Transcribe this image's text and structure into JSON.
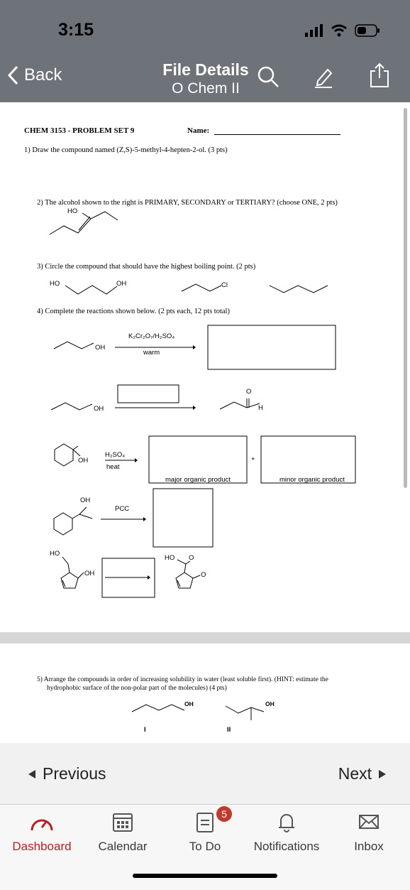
{
  "status": {
    "time": "3:15"
  },
  "header": {
    "back_label": "Back",
    "title": "File Details",
    "subtitle": "O Chem II"
  },
  "document": {
    "heading": "CHEM 3153 - PROBLEM SET 9",
    "name_label": "Name: ",
    "q1": "1)  Draw the compound named (Z,S)-5-methyl-4-hepten-2-ol. (3 pts)",
    "q2": "2)  The alcohol shown to the right is PRIMARY, SECONDARY or TERTIARY? (choose ONE, 2 pts)",
    "q3": "3)  Circle the compound that should have the highest boiling point. (2 pts)",
    "q4": "4)  Complete the reactions shown below. (2 pts each, 12 pts total)",
    "q5_line1": "5)  Arrange the compounds in order of increasing solubility in water (least soluble first). (HINT: estimate the",
    "q5_line2": "hydrophobic surface of the non-polar part of the molecules) (4 pts)",
    "labels": {
      "ho": "HO",
      "oh": "OH",
      "cl": "Cl",
      "o": "O",
      "h": "H",
      "reagent1": "K₂Cr₂O₇/H₂SO₄",
      "warm": "warm",
      "h2so4": "H₂SO₄",
      "heat": "heat",
      "pcc": "PCC",
      "plus": "+",
      "major": "major organic product",
      "minor": "minor organic product",
      "roman1": "I",
      "roman2": "II"
    }
  },
  "nav": {
    "previous": "Previous",
    "next": "Next"
  },
  "tabs": [
    {
      "label": "Dashboard"
    },
    {
      "label": "Calendar"
    },
    {
      "label": "To Do"
    },
    {
      "label": "Notifications"
    },
    {
      "label": "Inbox"
    }
  ],
  "todo_badge": "5",
  "colors": {
    "header_bg": "#6d7379",
    "active_tab": "#b22222",
    "badge": "#c0392b"
  }
}
